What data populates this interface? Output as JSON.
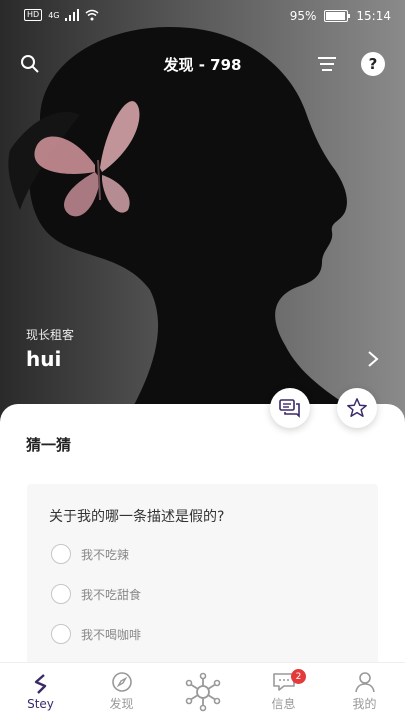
{
  "status_bar": {
    "net_left": "HD",
    "net_type": "4G",
    "battery": "95%",
    "time": "15:14"
  },
  "header": {
    "title": "发现 - 798"
  },
  "profile": {
    "role": "现长租客",
    "name": "hui"
  },
  "sheet": {
    "title": "猜一猜",
    "question": "关于我的哪一条描述是假的?",
    "options": [
      "我不吃辣",
      "我不吃甜食",
      "我不喝咖啡"
    ]
  },
  "nav": {
    "items": [
      {
        "label": "Stey",
        "icon": "stey-logo-icon"
      },
      {
        "label": "发现",
        "icon": "compass-icon"
      },
      {
        "label": "",
        "icon": "network-hub-icon"
      },
      {
        "label": "信息",
        "icon": "message-icon",
        "badge": "2"
      },
      {
        "label": "我的",
        "icon": "user-icon"
      }
    ]
  },
  "colors": {
    "accent": "#3b2a6a",
    "badge": "#e53a3a"
  }
}
